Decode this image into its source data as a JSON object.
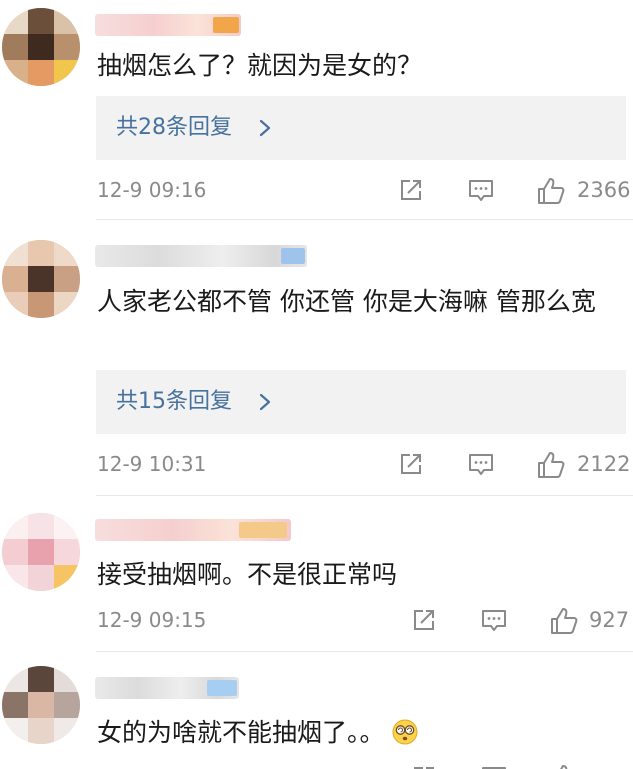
{
  "comments": [
    {
      "text": "抽烟怎么了？就因为是女的？",
      "replies": "共28条回复",
      "timestamp": "12-9 09:16",
      "likes": "2366"
    },
    {
      "text": "人家老公都不管 你还管 你是大海嘛 管那么宽",
      "replies": "共15条回复",
      "timestamp": "12-9 10:31",
      "likes": "2122"
    },
    {
      "text": "接受抽烟啊。不是很正常吗",
      "timestamp": "12-9 09:15",
      "likes": "927"
    },
    {
      "text": "女的为啥就不能抽烟了。。",
      "emoji": "dizzy-face-emoji"
    }
  ],
  "icons": {
    "share": "share-icon",
    "comment": "comment-icon",
    "like": "like-icon",
    "chevron": "chevron-right-icon"
  },
  "colors": {
    "reply_link": "#47729e",
    "meta_text": "#8a8a8a",
    "reply_bg": "#f2f2f2"
  }
}
